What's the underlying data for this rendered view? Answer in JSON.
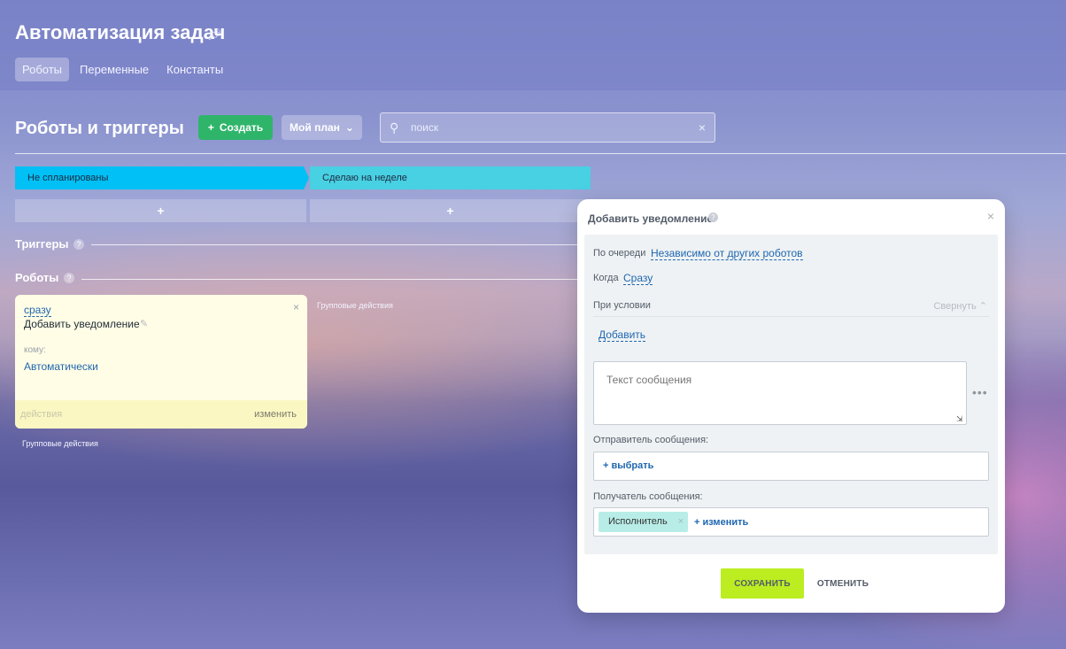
{
  "app": {
    "title": "Автоматизация задач",
    "tabs": [
      {
        "label": "Роботы",
        "active": true
      },
      {
        "label": "Переменные",
        "active": false
      },
      {
        "label": "Константы",
        "active": false
      }
    ]
  },
  "toolbar": {
    "section_title": "Роботы и триггеры",
    "create_label": "Создать",
    "plan_label": "Мой план",
    "search_placeholder": "поиск"
  },
  "stages": [
    {
      "label": "Не спланированы",
      "color": "#00c0f5"
    },
    {
      "label": "Сделаю на неделе",
      "color": "#48d0e3"
    }
  ],
  "add_stage_label": "+",
  "triggers": {
    "label": "Триггеры"
  },
  "robots": {
    "label": "Роботы",
    "group_actions": "Групповые действия",
    "card": {
      "when": "сразу",
      "title": "Добавить уведомление",
      "to_label": "кому:",
      "to_value": "Автоматически",
      "actions": "действия",
      "change": "изменить"
    }
  },
  "dialog": {
    "title": "Добавить уведомление",
    "order_label": "По очереди",
    "order_value": "Независимо от других роботов",
    "when_label": "Когда",
    "when_value": "Сразу",
    "condition_label": "При условии",
    "collapse_label": "Свернуть",
    "add_condition": "Добавить",
    "message_placeholder": "Текст сообщения",
    "sender_label": "Отправитель сообщения:",
    "sender_pick": "+ выбрать",
    "recipient_label": "Получатель сообщения:",
    "recipient_chip": "Исполнитель",
    "recipient_change": "+ изменить",
    "save_label": "СОХРАНИТЬ",
    "cancel_label": "ОТМЕНИТЬ"
  },
  "colors": {
    "accent_green": "#2fb56a",
    "save_button": "#bbed21",
    "link_blue": "#2067b0"
  }
}
